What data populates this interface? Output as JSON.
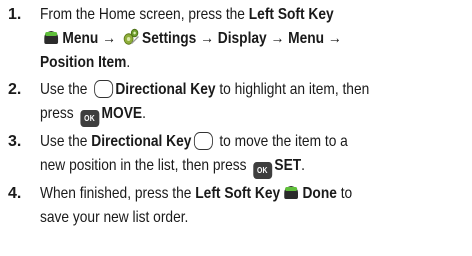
{
  "steps": [
    {
      "number": "1.",
      "lines": [
        [
          "From the Home screen, press the ",
          "Left Soft Key"
        ],
        [
          "Menu",
          " → ",
          "Settings",
          " → ",
          "Display",
          " → ",
          "Menu",
          " →"
        ],
        [
          "Position Item",
          "."
        ]
      ]
    },
    {
      "number": "2.",
      "lines": [
        [
          "Use the ",
          "Directional Key",
          " to highlight an item, then"
        ],
        [
          "press ",
          "OK",
          "MOVE",
          "."
        ]
      ]
    },
    {
      "number": "3.",
      "lines": [
        [
          "Use the ",
          "Directional Key",
          " to move the item to a"
        ],
        [
          "new position in the list, then press ",
          "OK",
          "SET",
          "."
        ]
      ]
    },
    {
      "number": "4.",
      "lines": [
        [
          "When finished, press the ",
          "Left Soft Key",
          "Done",
          " to"
        ],
        [
          "save your new list order."
        ]
      ]
    }
  ],
  "icons": {
    "soft_key": "left-soft-key-icon",
    "settings": "settings-gear-icon",
    "directional": "directional-key-icon",
    "ok": "ok-key-icon"
  }
}
